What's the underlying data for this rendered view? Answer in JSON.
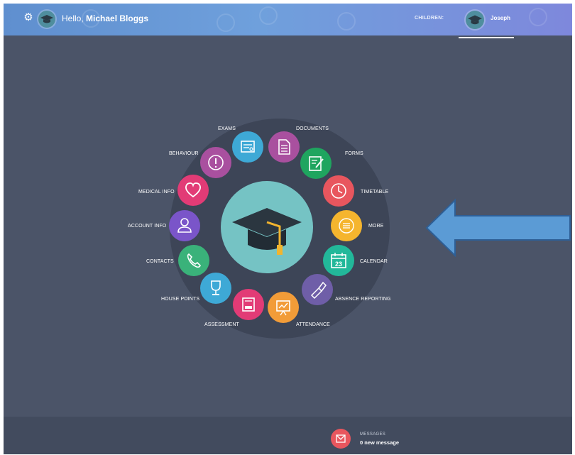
{
  "header": {
    "greeting_prefix": "Hello,",
    "user_name": "Michael Bloggs",
    "children_label": "CHILDREN:",
    "child_name": "Joseph"
  },
  "menu": {
    "items": [
      {
        "label": "EXAMS",
        "icon": "certificate-icon",
        "color": "#3ea9d6"
      },
      {
        "label": "DOCUMENTS",
        "icon": "document-icon",
        "color": "#a9509f"
      },
      {
        "label": "FORMS",
        "icon": "form-edit-icon",
        "color": "#1fa55f"
      },
      {
        "label": "TIMETABLE",
        "icon": "clock-icon",
        "color": "#e8565e"
      },
      {
        "label": "MORE",
        "icon": "more-icon",
        "color": "#f5b52e"
      },
      {
        "label": "CALENDAR",
        "icon": "calendar-icon",
        "color": "#22b89a"
      },
      {
        "label": "ABSENCE REPORTING",
        "icon": "flashlight-icon",
        "color": "#6f5ea8"
      },
      {
        "label": "ATTENDANCE",
        "icon": "chart-board-icon",
        "color": "#f29c38"
      },
      {
        "label": "ASSESSMENT",
        "icon": "notebook-icon",
        "color": "#e23b76"
      },
      {
        "label": "HOUSE POINTS",
        "icon": "trophy-icon",
        "color": "#3ea9d6"
      },
      {
        "label": "CONTACTS",
        "icon": "phone-icon",
        "color": "#3ab27a"
      },
      {
        "label": "ACCOUNT INFO",
        "icon": "user-icon",
        "color": "#7a55c9"
      },
      {
        "label": "MEDICAL INFO",
        "icon": "heart-icon",
        "color": "#e23b76"
      },
      {
        "label": "BEHAVIOUR",
        "icon": "alert-icon",
        "color": "#a9509f"
      }
    ],
    "calendar_day": "23"
  },
  "footer": {
    "messages_label": "MESSAGES",
    "messages_count": "0 new message"
  },
  "colors": {
    "background": "#4b5468",
    "dial": "#3d4557",
    "center": "#75c3c4",
    "arrow": "#5b9bd5"
  }
}
